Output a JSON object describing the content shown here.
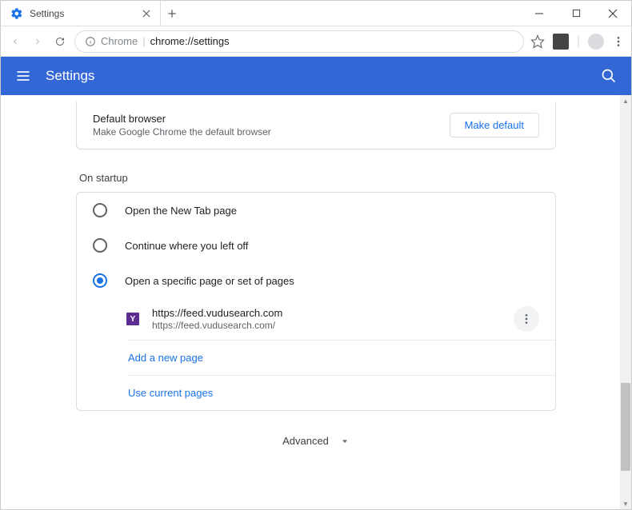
{
  "tab": {
    "title": "Settings"
  },
  "omnibox": {
    "prefix": "Chrome",
    "url": "chrome://settings"
  },
  "header": {
    "title": "Settings"
  },
  "default_browser": {
    "title": "Default browser",
    "subtitle": "Make Google Chrome the default browser",
    "button": "Make default"
  },
  "startup": {
    "section_label": "On startup",
    "options": [
      {
        "label": "Open the New Tab page",
        "checked": false
      },
      {
        "label": "Continue where you left off",
        "checked": false
      },
      {
        "label": "Open a specific page or set of pages",
        "checked": true
      }
    ],
    "page": {
      "favicon_letter": "Y",
      "title": "https://feed.vudusearch.com",
      "url": "https://feed.vudusearch.com/"
    },
    "add_page": "Add a new page",
    "use_current": "Use current pages"
  },
  "advanced": {
    "label": "Advanced"
  }
}
